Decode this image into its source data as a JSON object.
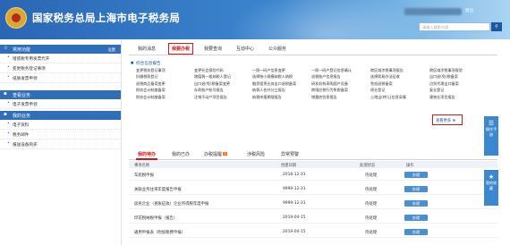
{
  "header": {
    "title": "国家税务总局上海市电子税务局",
    "links": "退出",
    "search_placeholder": "请输入搜索内容",
    "search_icon": "search-icon"
  },
  "sidebar": {
    "section1": {
      "label": "常用功能",
      "more": "设置"
    },
    "items1": [
      "增值税专用发票代开",
      "变更税务登记事项",
      "纸质发票申领"
    ],
    "section2": {
      "label": "查看业务"
    },
    "items2": [
      "电子发票申领"
    ],
    "section3": {
      "label": "我的业务"
    },
    "items3": [
      "电子资料",
      "税务邮件",
      "报送设备购买"
    ]
  },
  "tabs": [
    "我的消息",
    "我要办税",
    "我要查询",
    "互动中心",
    "公众服务"
  ],
  "services": {
    "heading": "综合信息报告",
    "items": [
      "变更税务登记事项",
      "变更社会保险代码",
      "一照一码户信息变更",
      "一照一码户登记信息确认",
      "跨区域涉税事项报告",
      "跨区域涉税事项报验",
      "扣缴税款登记",
      "增值税一般纳税人登记",
      "选择按小规模纳税人纳税",
      "退税账户信息报告",
      "选择简易办法征收",
      "出口退(免)税备案",
      "退税商品备案变更",
      "出口退(免)税备案变更",
      "融资租赁业务出口退税备案",
      "研发机构采购国产设备",
      "免抵退税备案",
      "边贸代理出口备案",
      "财务会计制度备案",
      "存款账户账号报告",
      "纳税人合并分立报告",
      "跨境应税行为免税备案",
      "停业登记",
      "复业登记",
      "财务会计制度备案",
      "注销不动产项目报告",
      "纳税申报期限报告",
      "增量房信息报告",
      "土地出(转)让信息采集",
      "建筑业项目报告"
    ],
    "more": "查看更多"
  },
  "panel": {
    "tabs": [
      "我的待办",
      "我的已办",
      "办税提醒",
      "涉税风险",
      "异常预警"
    ],
    "remind_badge": "6",
    "headers": [
      "事项名称",
      "创建日期",
      "处理状态",
      "操作"
    ],
    "rows": [
      {
        "name": "车船税申报",
        "date": "2018-12-31",
        "status": "待处理",
        "action": "办理"
      },
      {
        "name": "关联业务往来年度报告申报",
        "date": "9999-12-31",
        "status": "待处理",
        "action": "办理"
      },
      {
        "name": "居民企业（查账征收）企业所得税年度申报",
        "date": "9999-12-31",
        "status": "待处理",
        "action": "办理"
      },
      {
        "name": "印花税纳税申报（报告）",
        "date": "2019-04-15",
        "status": "待处理",
        "action": "办理"
      },
      {
        "name": "通用申报表（附加税费申报）",
        "date": "2019-04-15",
        "status": "待处理",
        "action": "办理"
      }
    ]
  },
  "float": {
    "top": "操作手册",
    "bottom": "我的收藏"
  }
}
